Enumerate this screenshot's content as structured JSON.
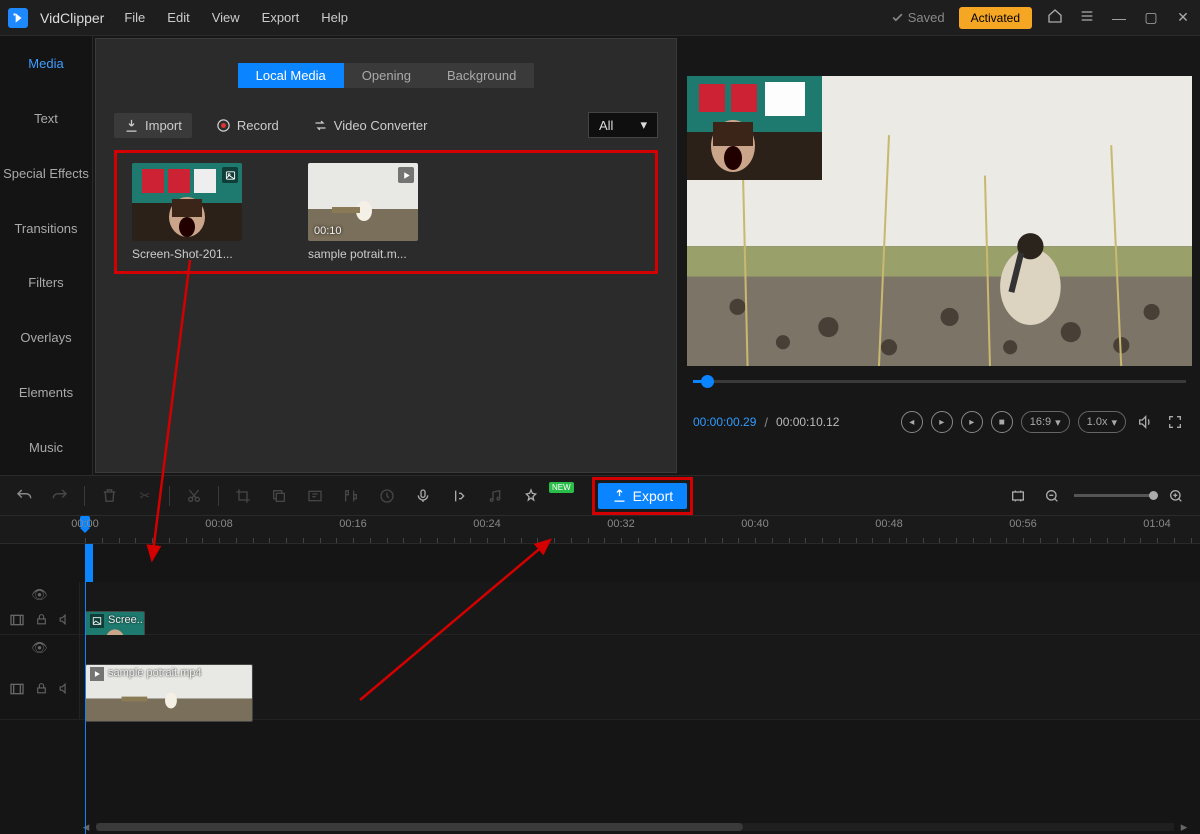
{
  "app": {
    "name": "VidClipper"
  },
  "menu": [
    "File",
    "Edit",
    "View",
    "Export",
    "Help"
  ],
  "status": {
    "saved": "Saved",
    "activated": "Activated"
  },
  "leftnav": [
    "Media",
    "Text",
    "Special Effects",
    "Transitions",
    "Filters",
    "Overlays",
    "Elements",
    "Music"
  ],
  "mediaTabs": [
    "Local Media",
    "Opening",
    "Background"
  ],
  "mediaActions": {
    "import": "Import",
    "record": "Record",
    "convert": "Video Converter"
  },
  "mediaFilter": "All",
  "mediaItems": [
    {
      "label": "Screen-Shot-201...",
      "duration": "",
      "type": "image"
    },
    {
      "label": "sample potrait.m...",
      "duration": "00:10",
      "type": "video"
    }
  ],
  "preview": {
    "current": "00:00:00.29",
    "total": "00:00:10.12",
    "aspect": "16:9",
    "speed": "1.0x"
  },
  "toolbar": {
    "export": "Export",
    "new": "NEW"
  },
  "ruler": [
    "00:00",
    "00:08",
    "00:16",
    "00:24",
    "00:32",
    "00:40",
    "00:48",
    "00:56",
    "01:04"
  ],
  "clips": [
    {
      "track": 0,
      "label": "Scree...",
      "left": 0,
      "width": 60,
      "icon": "image"
    },
    {
      "track": 1,
      "label": "sample potrait.mp4",
      "left": 0,
      "width": 168,
      "icon": "video"
    }
  ]
}
